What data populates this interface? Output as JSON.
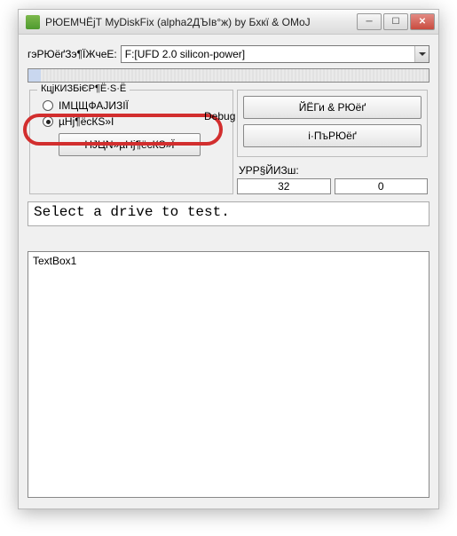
{
  "window": {
    "title": "РЮЕМЧЁјТ MyDiskFix (alpha2ДЪІв°ж) by Бхкї & OMoJ"
  },
  "labels": {
    "drive_select": "гэРЮёґЗэ¶ЇЖчеЕ:"
  },
  "combo": {
    "selected": "F:[UFD 2.0 silicon-power]"
  },
  "group": {
    "legend": "КцјКИЗБіЄР¶Ё·Ѕ·Ё"
  },
  "radios": {
    "r1": "ІМЦЩФАЈИЗІЇ",
    "r2": "µНј¶ёсКЅ»Ї"
  },
  "buttons": {
    "edit": "HJЦN»µНј¶ёсКЅ»Ї",
    "top": "ЙЁГи & РЮёґ",
    "bottom": "і·ПъРЮёґ"
  },
  "debug_label": "Debug",
  "stats": {
    "label": "УРР§ЙИЗш:",
    "v1": "32",
    "v2": "0"
  },
  "status_line": "Select a drive to test.",
  "textbox_content": "TextBox1"
}
